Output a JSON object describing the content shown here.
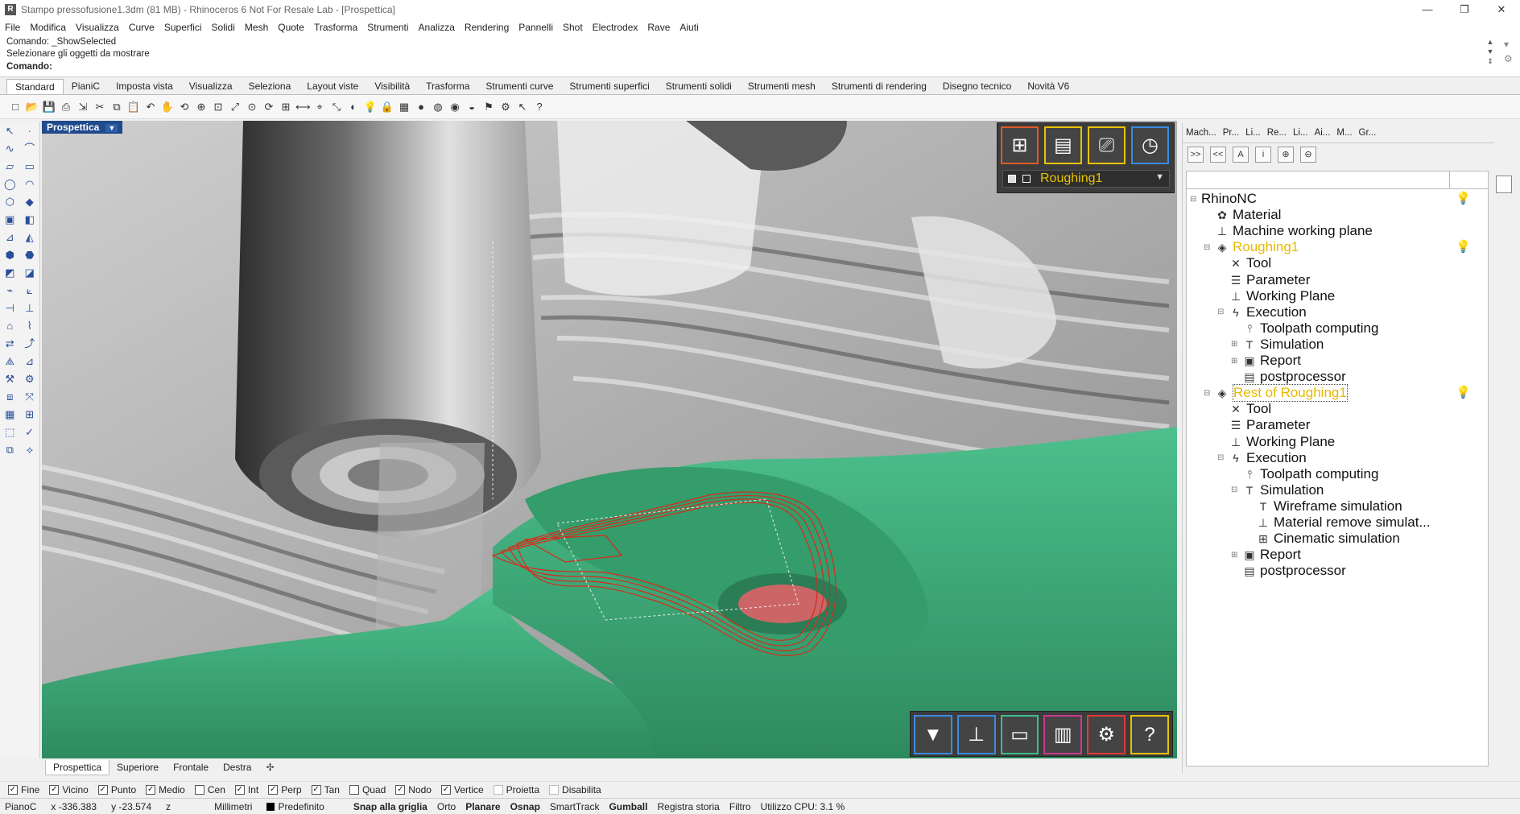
{
  "window": {
    "title": "Stampo pressofusione1.3dm (81 MB) - Rhinoceros 6 Not For Resale Lab - [Prospettica]",
    "controls": [
      "—",
      "❐",
      "✕"
    ]
  },
  "menu": [
    "File",
    "Modifica",
    "Visualizza",
    "Curve",
    "Superfici",
    "Solidi",
    "Mesh",
    "Quote",
    "Trasforma",
    "Strumenti",
    "Analizza",
    "Rendering",
    "Pannelli",
    "Shot",
    "Electrodex",
    "Rave",
    "Aiuti"
  ],
  "command": {
    "line1": "Comando: _ShowSelected",
    "line2": "Selezionare gli oggetti da mostrare",
    "prompt": "Comando:"
  },
  "toolbar_tabs": [
    "Standard",
    "PianiC",
    "Imposta vista",
    "Visualizza",
    "Seleziona",
    "Layout viste",
    "Visibilità",
    "Trasforma",
    "Strumenti curve",
    "Strumenti superfici",
    "Strumenti solidi",
    "Strumenti mesh",
    "Strumenti di rendering",
    "Disegno tecnico",
    "Novità V6"
  ],
  "toolbar_icons": [
    "new-icon",
    "open-icon",
    "save-icon",
    "print-icon",
    "import-icon",
    "cut-icon",
    "copy-icon",
    "paste-icon",
    "undo-icon",
    "pan-icon",
    "rotate-icon",
    "zoom-icon",
    "zoom-window-icon",
    "zoom-extents-icon",
    "zoom-selected-icon",
    "rotate-view-icon",
    "grid-icon",
    "dimension-icon",
    "snap-icon",
    "transform-icon",
    "display-icon",
    "light-icon",
    "lock-icon",
    "layer-icon",
    "color-icon",
    "material-icon",
    "render-icon",
    "environment-icon",
    "options-icon",
    "gear-icon",
    "cursor-icon",
    "help-icon"
  ],
  "viewport": {
    "label": "Prospettica",
    "tabs": [
      "Prospettica",
      "Superiore",
      "Frontale",
      "Destra"
    ],
    "add_tab": "✢"
  },
  "cnc": {
    "top_buttons": [
      {
        "name": "new-operation-icon",
        "glyph": "⊞",
        "color": "#e05a2a"
      },
      {
        "name": "stock-icon",
        "glyph": "▤",
        "color": "#e8c400"
      },
      {
        "name": "computer-icon",
        "glyph": "⎚",
        "color": "#e8c400"
      },
      {
        "name": "clock-icon",
        "glyph": "◷",
        "color": "#3a8be0"
      }
    ],
    "selected_operation": "Roughing1",
    "bottom_buttons": [
      {
        "name": "tool-icon",
        "glyph": "▼",
        "color": "#3a8be0"
      },
      {
        "name": "machine-icon",
        "glyph": "⊥",
        "color": "#3a8be0"
      },
      {
        "name": "block-icon",
        "glyph": "▭",
        "color": "#3cbf8c"
      },
      {
        "name": "cabinet-icon",
        "glyph": "▥",
        "color": "#c83a8c"
      },
      {
        "name": "settings-icon",
        "glyph": "⚙",
        "color": "#e03a3a"
      },
      {
        "name": "help-icon",
        "glyph": "?",
        "color": "#e8c400"
      }
    ]
  },
  "panel": {
    "tabs": [
      "Mach...",
      "Pr...",
      "Li...",
      "Re...",
      "Li...",
      "Ai...",
      "M...",
      "Gr..."
    ],
    "buttons": [
      ">>",
      "<<",
      "A",
      "i",
      "⊕",
      "⊖"
    ],
    "tree": [
      {
        "label": "RhinoNC",
        "level": 0,
        "icon": "",
        "exp": "⊟",
        "bulb": "on"
      },
      {
        "label": "Material",
        "level": 1,
        "icon": "✿"
      },
      {
        "label": "Machine working plane",
        "level": 1,
        "icon": "⊥"
      },
      {
        "label": "Roughing1",
        "level": 1,
        "icon": "◈",
        "exp": "⊟",
        "bulb": "off",
        "style": "yellow"
      },
      {
        "label": "Tool",
        "level": 2,
        "icon": "✕"
      },
      {
        "label": "Parameter",
        "level": 2,
        "icon": "☰"
      },
      {
        "label": "Working Plane",
        "level": 2,
        "icon": "⊥"
      },
      {
        "label": "Execution",
        "level": 2,
        "icon": "ϟ",
        "exp": "⊟"
      },
      {
        "label": "Toolpath computing",
        "level": 3,
        "icon": "⫯"
      },
      {
        "label": "Simulation",
        "level": 3,
        "icon": "T",
        "exp": "⊞"
      },
      {
        "label": "Report",
        "level": 3,
        "icon": "▣",
        "exp": "⊞"
      },
      {
        "label": "postprocessor",
        "level": 3,
        "icon": "▤"
      },
      {
        "label": "Rest of Roughing1",
        "level": 1,
        "icon": "◈",
        "exp": "⊟",
        "bulb": "on",
        "style": "yellow boxed"
      },
      {
        "label": "Tool",
        "level": 2,
        "icon": "✕"
      },
      {
        "label": "Parameter",
        "level": 2,
        "icon": "☰"
      },
      {
        "label": "Working Plane",
        "level": 2,
        "icon": "⊥"
      },
      {
        "label": "Execution",
        "level": 2,
        "icon": "ϟ",
        "exp": "⊟"
      },
      {
        "label": "Toolpath computing",
        "level": 3,
        "icon": "⫯"
      },
      {
        "label": "Simulation",
        "level": 3,
        "icon": "T",
        "exp": "⊟"
      },
      {
        "label": "Wireframe simulation",
        "level": 4,
        "icon": "T"
      },
      {
        "label": "Material remove simulat...",
        "level": 4,
        "icon": "⊥"
      },
      {
        "label": "Cinematic simulation",
        "level": 4,
        "icon": "⊞"
      },
      {
        "label": "Report",
        "level": 3,
        "icon": "▣",
        "exp": "⊞"
      },
      {
        "label": "postprocessor",
        "level": 3,
        "icon": "▤"
      }
    ]
  },
  "osnap": [
    {
      "label": "Fine",
      "checked": true
    },
    {
      "label": "Vicino",
      "checked": true
    },
    {
      "label": "Punto",
      "checked": true
    },
    {
      "label": "Medio",
      "checked": true
    },
    {
      "label": "Cen",
      "checked": false
    },
    {
      "label": "Int",
      "checked": true
    },
    {
      "label": "Perp",
      "checked": true
    },
    {
      "label": "Tan",
      "checked": true
    },
    {
      "label": "Quad",
      "checked": false
    },
    {
      "label": "Nodo",
      "checked": true
    },
    {
      "label": "Vertice",
      "checked": true
    },
    {
      "label": "Proietta",
      "checked": false
    },
    {
      "label": "Disabilita",
      "checked": false
    }
  ],
  "status": {
    "cplane": "PianoC",
    "x": "x -336.383",
    "y": "y -23.574",
    "z": "z",
    "units": "Millimetri",
    "layer": "Predefinito",
    "items": [
      "Snap alla griglia",
      "Orto",
      "Planare",
      "Osnap",
      "SmartTrack",
      "Gumball",
      "Registra storia",
      "Filtro"
    ],
    "bold_items": [
      "Snap alla griglia",
      "Planare",
      "Osnap",
      "Gumball"
    ],
    "cpu": "Utilizzo CPU: 3.1 %"
  },
  "colors": {
    "mold_green": "#3fa878",
    "toolpath_red": "#d82a1a",
    "accent_yellow": "#e8c400"
  }
}
